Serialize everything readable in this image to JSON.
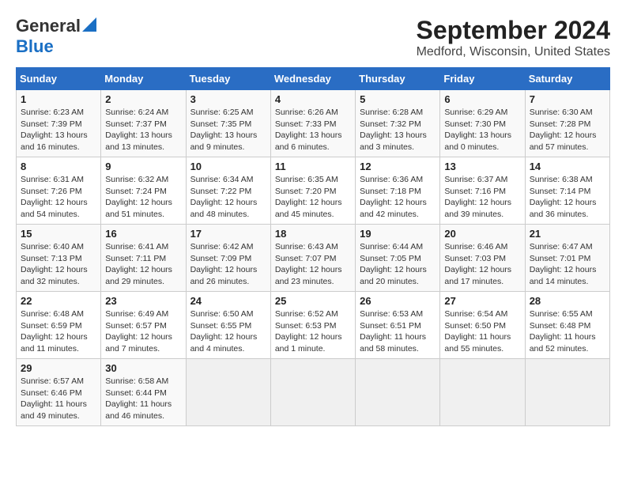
{
  "header": {
    "logo_line1": "General",
    "logo_line2": "Blue",
    "title": "September 2024",
    "subtitle": "Medford, Wisconsin, United States"
  },
  "calendar": {
    "days_of_week": [
      "Sunday",
      "Monday",
      "Tuesday",
      "Wednesday",
      "Thursday",
      "Friday",
      "Saturday"
    ],
    "weeks": [
      [
        {
          "day": "1",
          "sunrise": "6:23 AM",
          "sunset": "7:39 PM",
          "daylight": "13 hours and 16 minutes."
        },
        {
          "day": "2",
          "sunrise": "6:24 AM",
          "sunset": "7:37 PM",
          "daylight": "13 hours and 13 minutes."
        },
        {
          "day": "3",
          "sunrise": "6:25 AM",
          "sunset": "7:35 PM",
          "daylight": "13 hours and 9 minutes."
        },
        {
          "day": "4",
          "sunrise": "6:26 AM",
          "sunset": "7:33 PM",
          "daylight": "13 hours and 6 minutes."
        },
        {
          "day": "5",
          "sunrise": "6:28 AM",
          "sunset": "7:32 PM",
          "daylight": "13 hours and 3 minutes."
        },
        {
          "day": "6",
          "sunrise": "6:29 AM",
          "sunset": "7:30 PM",
          "daylight": "13 hours and 0 minutes."
        },
        {
          "day": "7",
          "sunrise": "6:30 AM",
          "sunset": "7:28 PM",
          "daylight": "12 hours and 57 minutes."
        }
      ],
      [
        {
          "day": "8",
          "sunrise": "6:31 AM",
          "sunset": "7:26 PM",
          "daylight": "12 hours and 54 minutes."
        },
        {
          "day": "9",
          "sunrise": "6:32 AM",
          "sunset": "7:24 PM",
          "daylight": "12 hours and 51 minutes."
        },
        {
          "day": "10",
          "sunrise": "6:34 AM",
          "sunset": "7:22 PM",
          "daylight": "12 hours and 48 minutes."
        },
        {
          "day": "11",
          "sunrise": "6:35 AM",
          "sunset": "7:20 PM",
          "daylight": "12 hours and 45 minutes."
        },
        {
          "day": "12",
          "sunrise": "6:36 AM",
          "sunset": "7:18 PM",
          "daylight": "12 hours and 42 minutes."
        },
        {
          "day": "13",
          "sunrise": "6:37 AM",
          "sunset": "7:16 PM",
          "daylight": "12 hours and 39 minutes."
        },
        {
          "day": "14",
          "sunrise": "6:38 AM",
          "sunset": "7:14 PM",
          "daylight": "12 hours and 36 minutes."
        }
      ],
      [
        {
          "day": "15",
          "sunrise": "6:40 AM",
          "sunset": "7:13 PM",
          "daylight": "12 hours and 32 minutes."
        },
        {
          "day": "16",
          "sunrise": "6:41 AM",
          "sunset": "7:11 PM",
          "daylight": "12 hours and 29 minutes."
        },
        {
          "day": "17",
          "sunrise": "6:42 AM",
          "sunset": "7:09 PM",
          "daylight": "12 hours and 26 minutes."
        },
        {
          "day": "18",
          "sunrise": "6:43 AM",
          "sunset": "7:07 PM",
          "daylight": "12 hours and 23 minutes."
        },
        {
          "day": "19",
          "sunrise": "6:44 AM",
          "sunset": "7:05 PM",
          "daylight": "12 hours and 20 minutes."
        },
        {
          "day": "20",
          "sunrise": "6:46 AM",
          "sunset": "7:03 PM",
          "daylight": "12 hours and 17 minutes."
        },
        {
          "day": "21",
          "sunrise": "6:47 AM",
          "sunset": "7:01 PM",
          "daylight": "12 hours and 14 minutes."
        }
      ],
      [
        {
          "day": "22",
          "sunrise": "6:48 AM",
          "sunset": "6:59 PM",
          "daylight": "12 hours and 11 minutes."
        },
        {
          "day": "23",
          "sunrise": "6:49 AM",
          "sunset": "6:57 PM",
          "daylight": "12 hours and 7 minutes."
        },
        {
          "day": "24",
          "sunrise": "6:50 AM",
          "sunset": "6:55 PM",
          "daylight": "12 hours and 4 minutes."
        },
        {
          "day": "25",
          "sunrise": "6:52 AM",
          "sunset": "6:53 PM",
          "daylight": "12 hours and 1 minute."
        },
        {
          "day": "26",
          "sunrise": "6:53 AM",
          "sunset": "6:51 PM",
          "daylight": "11 hours and 58 minutes."
        },
        {
          "day": "27",
          "sunrise": "6:54 AM",
          "sunset": "6:50 PM",
          "daylight": "11 hours and 55 minutes."
        },
        {
          "day": "28",
          "sunrise": "6:55 AM",
          "sunset": "6:48 PM",
          "daylight": "11 hours and 52 minutes."
        }
      ],
      [
        {
          "day": "29",
          "sunrise": "6:57 AM",
          "sunset": "6:46 PM",
          "daylight": "11 hours and 49 minutes."
        },
        {
          "day": "30",
          "sunrise": "6:58 AM",
          "sunset": "6:44 PM",
          "daylight": "11 hours and 46 minutes."
        },
        null,
        null,
        null,
        null,
        null
      ]
    ]
  }
}
